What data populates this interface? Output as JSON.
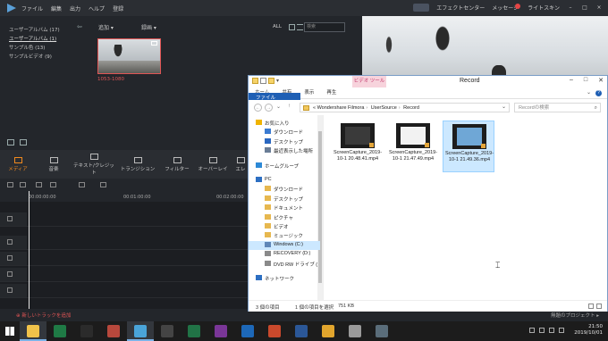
{
  "filmora": {
    "menu": [
      "ファイル",
      "編集",
      "出力",
      "ヘルプ",
      "登録"
    ],
    "right_items": [
      "エフェクトセンター",
      "メッセージ",
      "ライトスキン"
    ],
    "library": [
      {
        "label": "ユーザーアルバム (17)",
        "active": false
      },
      {
        "label": "ユーザーアルバム (1)",
        "active": true
      },
      {
        "label": "サンプル色 (13)",
        "active": false
      },
      {
        "label": "サンプルビデオ (9)",
        "active": false
      }
    ],
    "media_toolbar": {
      "import": "追加",
      "record": "録画",
      "all": "ALL",
      "search_placeholder": "検索"
    },
    "thumb_label": "1053-1080",
    "tabs": [
      {
        "label": "メディア",
        "active": true
      },
      {
        "label": "音楽",
        "active": false
      },
      {
        "label": "テキスト/クレジット",
        "active": false
      },
      {
        "label": "トランジション",
        "active": false
      },
      {
        "label": "フィルター",
        "active": false
      },
      {
        "label": "オーバーレイ",
        "active": false
      },
      {
        "label": "エレ",
        "active": false
      }
    ],
    "ruler": [
      "00:00:00:00",
      "00:01:00:00",
      "00:02:00:00"
    ],
    "add_track": "新しいトラックを追加",
    "project_name": "無題のプロジェクト"
  },
  "explorer": {
    "context_tab": "ビデオ ツール",
    "title": "Record",
    "ribbon": [
      "ファイル",
      "ホーム",
      "共有",
      "表示",
      "再生"
    ],
    "address": [
      "Wondershare Filmora",
      "UserSource",
      "Record"
    ],
    "address_prefix": "«",
    "search_placeholder": "Recordの検索",
    "nav": [
      {
        "label": "お気に入り",
        "indent": 0,
        "icon": "star-icon",
        "color": "#f0b400"
      },
      {
        "label": "ダウンロード",
        "indent": 1,
        "icon": "folder-icon",
        "color": "#3b7bd1"
      },
      {
        "label": "デスクトップ",
        "indent": 1,
        "icon": "folder-icon",
        "color": "#2a67c0"
      },
      {
        "label": "最近表示した場所",
        "indent": 1,
        "icon": "folder-icon",
        "color": "#6a7d96"
      },
      {
        "label": "ホームグループ",
        "indent": 0,
        "icon": "homegroup-icon",
        "color": "#2d89d6",
        "gap": true
      },
      {
        "label": "PC",
        "indent": 0,
        "icon": "pc-icon",
        "color": "#2d6fc2",
        "gap": true
      },
      {
        "label": "ダウンロード",
        "indent": 1,
        "icon": "folder-icon",
        "color": "#e7b84f"
      },
      {
        "label": "デスクトップ",
        "indent": 1,
        "icon": "folder-icon",
        "color": "#e7b84f"
      },
      {
        "label": "ドキュメント",
        "indent": 1,
        "icon": "folder-icon",
        "color": "#e7b84f"
      },
      {
        "label": "ピクチャ",
        "indent": 1,
        "icon": "folder-icon",
        "color": "#e7b84f"
      },
      {
        "label": "ビデオ",
        "indent": 1,
        "icon": "folder-icon",
        "color": "#e7b84f"
      },
      {
        "label": "ミュージック",
        "indent": 1,
        "icon": "folder-icon",
        "color": "#e7b84f"
      },
      {
        "label": "Windows (C:)",
        "indent": 1,
        "icon": "drive-icon",
        "color": "#5f87b8",
        "selected": true
      },
      {
        "label": "RECOVERY (D:)",
        "indent": 1,
        "icon": "drive-icon",
        "color": "#8a8a8a"
      },
      {
        "label": "DVD RW ドライブ (",
        "indent": 1,
        "icon": "dvd-icon",
        "color": "#8a8a8a"
      },
      {
        "label": "ネットワーク",
        "indent": 0,
        "icon": "network-icon",
        "color": "#2d6fc2",
        "gap": true
      }
    ],
    "files": [
      {
        "name": "ScreenCapture_2019-10-1 20.48.41.mp4",
        "selected": false,
        "theme": "#3a3a3a"
      },
      {
        "name": "ScreenCapture_2019-10-1 21.47.49.mp4",
        "selected": false,
        "theme": "#f2f2f2"
      },
      {
        "name": "ScreenCapture_2019-10-1 21.49.36.mp4",
        "selected": true,
        "theme": "#6fa7d6"
      }
    ],
    "status": {
      "count": "3 個の項目",
      "selected": "1 個の項目を選択",
      "size": "751 KB"
    }
  },
  "taskbar": {
    "apps": [
      {
        "name": "file-explorer-icon",
        "color": "#f0c24a",
        "active": true
      },
      {
        "name": "excel-icon",
        "color": "#1f7a45",
        "active": false
      },
      {
        "name": "obs-icon",
        "color": "#2b2b2b",
        "active": false
      },
      {
        "name": "photos-icon",
        "color": "#b7483c",
        "active": false
      },
      {
        "name": "filmora-icon",
        "color": "#4aa4d9",
        "active": true
      },
      {
        "name": "camera-icon",
        "color": "#444",
        "active": false
      },
      {
        "name": "excel-2-icon",
        "color": "#217346",
        "active": false
      },
      {
        "name": "onenote-icon",
        "color": "#7a3697",
        "active": false
      },
      {
        "name": "outlook-icon",
        "color": "#1d68b8",
        "active": false
      },
      {
        "name": "powerpoint-icon",
        "color": "#c9492c",
        "active": false
      },
      {
        "name": "word-icon",
        "color": "#2b5797",
        "active": false
      },
      {
        "name": "chrome-icon",
        "color": "#e1a52d",
        "active": false
      },
      {
        "name": "hp-icon",
        "color": "#9a9a9a",
        "active": false
      },
      {
        "name": "app-icon",
        "color": "#5a6d7a",
        "active": false
      }
    ],
    "time": "21:50",
    "date": "2019/10/01"
  }
}
